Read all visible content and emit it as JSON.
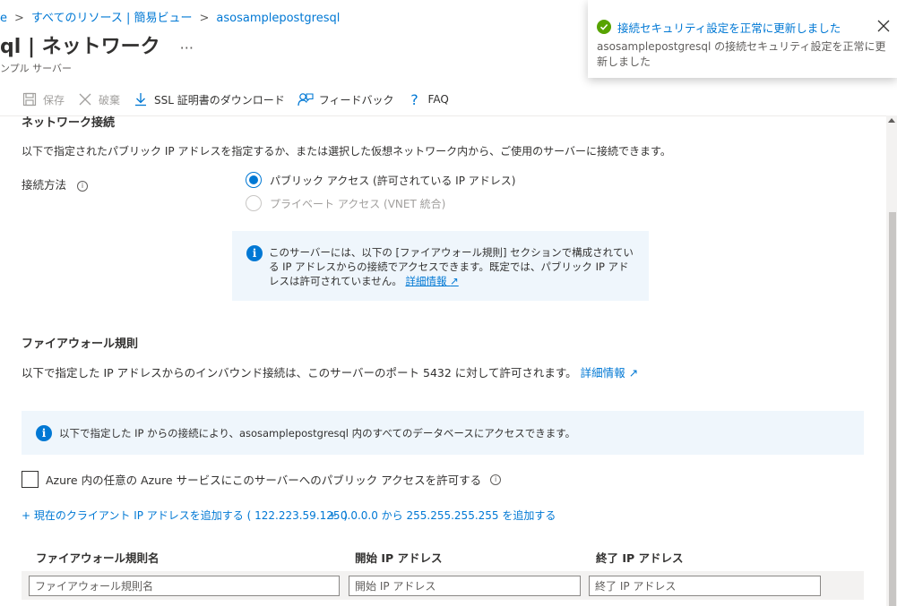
{
  "breadcrumb": {
    "items": [
      "e",
      "すべてのリソース | 簡易ビュー",
      "asosamplepostgresql"
    ],
    "separator": ">"
  },
  "header": {
    "title": "ql | ネットワーク",
    "more": "···",
    "subtitle": "ンプル サーバー"
  },
  "toolbar": {
    "save": "保存",
    "discard": "破棄",
    "download_ssl": "SSL 証明書のダウンロード",
    "feedback": "フィードバック",
    "faq": "FAQ"
  },
  "network": {
    "heading": "ネットワーク接続",
    "description": "以下で指定されたパブリック IP アドレスを指定するか、または選択した仮想ネットワーク内から、ご使用のサーバーに接続できます。",
    "method_label": "接続方法",
    "option_public": "パブリック アクセス (許可されている IP アドレス)",
    "option_private": "プライベート アクセス (VNET 統合)",
    "info_text": "このサーバーには、以下の [ファイアウォール規則] セクションで構成されている IP アドレスからの接続でアクセスできます。既定では、パブリック IP アドレスは許可されていません。",
    "info_link": "詳細情報"
  },
  "firewall": {
    "heading": "ファイアウォール規則",
    "description": "以下で指定した IP アドレスからのインバウンド接続は、このサーバーのポート 5432 に対して許可されます。",
    "description_link": "詳細情報",
    "info_text": "以下で指定した IP からの接続により、asosamplepostgresql 内のすべてのデータベースにアクセスできます。",
    "allow_azure_label": "Azure 内の任意の Azure サービスにこのサーバーへのパブリック アクセスを許可する",
    "add_client_ip": "+ 現在のクライアント IP アドレスを追加する ( 122.223.59.125 )",
    "add_all_ip": "+ 0.0.0.0 から 255.255.255.255 を追加する",
    "columns": [
      "ファイアウォール規則名",
      "開始 IP アドレス",
      "終了 IP アドレス"
    ],
    "placeholders": {
      "name": "ファイアウォール規則名",
      "start": "開始 IP アドレス",
      "end": "終了 IP アドレス"
    }
  },
  "toast": {
    "title": "接続セキュリティ設定を正常に更新しました",
    "body": "asosamplepostgresql の接続セキュリティ設定を正常に更新しました"
  },
  "colors": {
    "accent": "#0078d4",
    "success": "#57a300",
    "info_bg": "#eff6fc"
  }
}
